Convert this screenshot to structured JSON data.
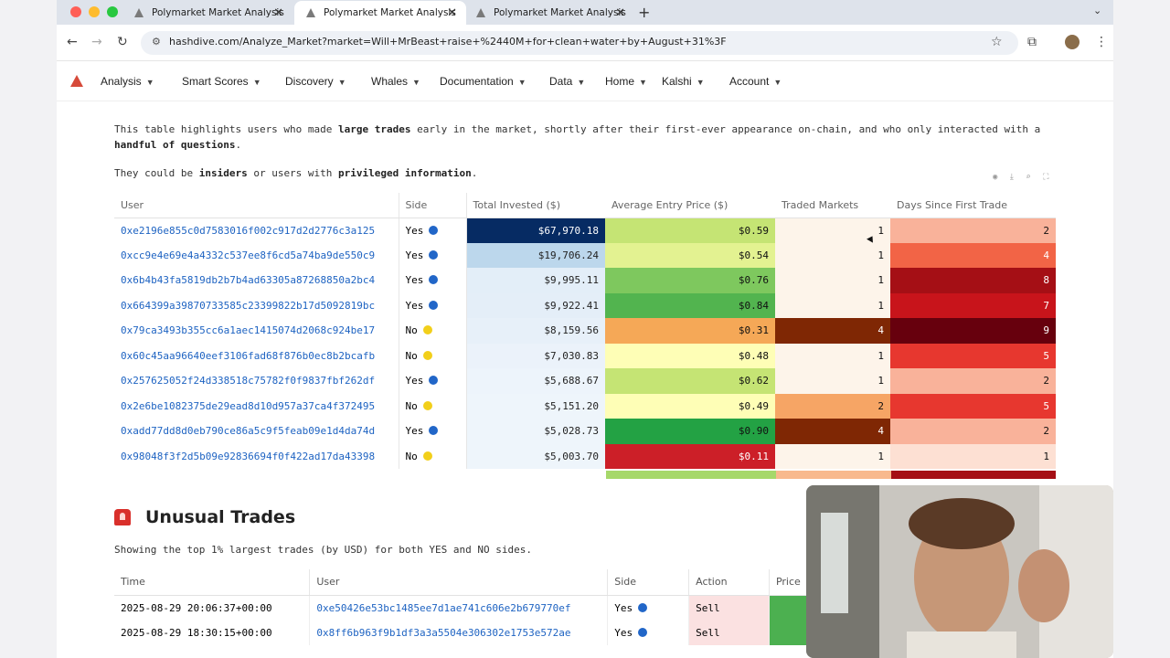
{
  "browser": {
    "tabs": [
      {
        "title": "Polymarket Market Analysis",
        "active": false
      },
      {
        "title": "Polymarket Market Analysis",
        "active": true
      },
      {
        "title": "Polymarket Market Analysis",
        "active": false
      }
    ],
    "url": "hashdive.com/Analyze_Market?market=Will+MrBeast+raise+%2440M+for+clean+water+by+August+31%3F"
  },
  "nav": {
    "items": [
      "Analysis",
      "Smart Scores",
      "Discovery",
      "Whales",
      "Documentation",
      "Data",
      "Home",
      "Kalshi",
      "Account"
    ]
  },
  "insiders": {
    "description_parts": [
      "This table highlights users who made ",
      "large trades",
      " early in the market, shortly after their first-ever appearance on-chain, and who only interacted with a ",
      "handful of questions",
      "."
    ],
    "note_parts": [
      "They could be ",
      "insiders",
      " or users with ",
      "privileged information",
      "."
    ],
    "columns": [
      "User",
      "Side",
      "Total Invested ($)",
      "Average Entry Price ($)",
      "Traded Markets",
      "Days Since First Trade"
    ],
    "rows": [
      {
        "user": "0xe2196e855c0d7583016f002c917d2d2776c3a125",
        "side": "Yes",
        "invested": "$67,970.18",
        "price": "$0.59",
        "markets": "1",
        "days": "2"
      },
      {
        "user": "0xcc9e4e69e4a4332c537ee8f6cd5a74ba9de550c9",
        "side": "Yes",
        "invested": "$19,706.24",
        "price": "$0.54",
        "markets": "1",
        "days": "4"
      },
      {
        "user": "0x6b4b43fa5819db2b7b4ad63305a87268850a2bc4",
        "side": "Yes",
        "invested": "$9,995.11",
        "price": "$0.76",
        "markets": "1",
        "days": "8"
      },
      {
        "user": "0x664399a39870733585c23399822b17d5092819bc",
        "side": "Yes",
        "invested": "$9,922.41",
        "price": "$0.84",
        "markets": "1",
        "days": "7"
      },
      {
        "user": "0x79ca3493b355cc6a1aec1415074d2068c924be17",
        "side": "No",
        "invested": "$8,159.56",
        "price": "$0.31",
        "markets": "4",
        "days": "9"
      },
      {
        "user": "0x60c45aa96640eef3106fad68f876b0ec8b2bcafb",
        "side": "No",
        "invested": "$7,030.83",
        "price": "$0.48",
        "markets": "1",
        "days": "5"
      },
      {
        "user": "0x257625052f24d338518c75782f0f9837fbf262df",
        "side": "Yes",
        "invested": "$5,688.67",
        "price": "$0.62",
        "markets": "1",
        "days": "2"
      },
      {
        "user": "0x2e6be1082375de29ead8d10d957a37ca4f372495",
        "side": "No",
        "invested": "$5,151.20",
        "price": "$0.49",
        "markets": "2",
        "days": "5"
      },
      {
        "user": "0xadd77dd8d0eb790ce86a5c9f5feab09e1d4da74d",
        "side": "Yes",
        "invested": "$5,028.73",
        "price": "$0.90",
        "markets": "4",
        "days": "2"
      },
      {
        "user": "0x98048f3f2d5b09e92836694f0f422ad17da43398",
        "side": "No",
        "invested": "$5,003.70",
        "price": "$0.11",
        "markets": "1",
        "days": "1"
      }
    ]
  },
  "unusual": {
    "title": "Unusual Trades",
    "subtitle": "Showing the top 1% largest trades (by USD) for both YES and NO sides.",
    "columns": [
      "Time",
      "User",
      "Side",
      "Action",
      "Price"
    ],
    "rows": [
      {
        "time": "2025-08-29 20:06:37+00:00",
        "user": "0xe50426e53bc1485ee7d1ae741c606e2b679770ef",
        "side": "Yes",
        "action": "Sell"
      },
      {
        "time": "2025-08-29 18:30:15+00:00",
        "user": "0x8ff6b963f9b1df3a3a5504e306302e1753e572ae",
        "side": "Yes",
        "action": "Sell"
      }
    ]
  },
  "colors": {
    "link": "#1e63c2",
    "yes_dot": "#2166c8",
    "no_dot": "#f2cf1a"
  }
}
